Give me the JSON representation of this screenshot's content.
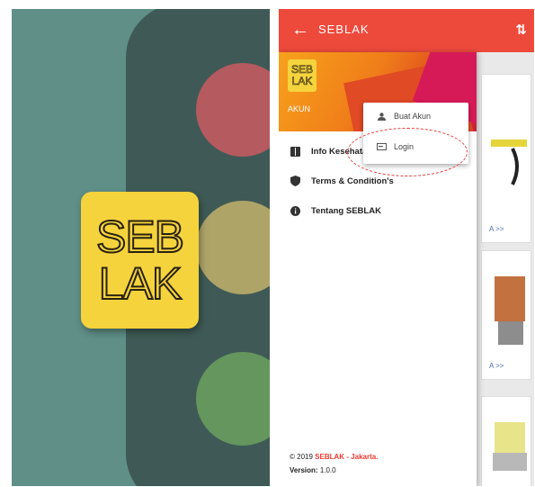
{
  "splash": {
    "logo_line1": "SEB",
    "logo_line2": "LAK"
  },
  "appbar": {
    "title": "SEBLAK",
    "back_icon": "arrow-left-icon",
    "sort_icon": "sort-icon"
  },
  "drawer": {
    "logo_line1": "SEB",
    "logo_line2": "LAK",
    "account_label": "AKUN",
    "items": [
      {
        "label": "Info Kesehatan",
        "icon": "book-icon"
      },
      {
        "label": "Terms & Condition's",
        "icon": "shield-icon"
      },
      {
        "label": "Tentang SEBLAK",
        "icon": "info-icon"
      }
    ],
    "footer": {
      "copyright_prefix": "© 2019",
      "brand": "SEBLAK",
      "location": "- Jakarta.",
      "version_label": "Version:",
      "version_value": "1.0.0"
    }
  },
  "popup": {
    "items": [
      {
        "label": "Buat Akun",
        "icon": "person-icon"
      },
      {
        "label": "Login",
        "icon": "login-icon"
      }
    ]
  },
  "cards": {
    "link_text": "A >>"
  },
  "colors": {
    "appbar": "#ee4a3c",
    "brand_red": "#ee3b32",
    "logo_yellow": "#f5d33d",
    "highlight_ring": "#e83b3b"
  }
}
